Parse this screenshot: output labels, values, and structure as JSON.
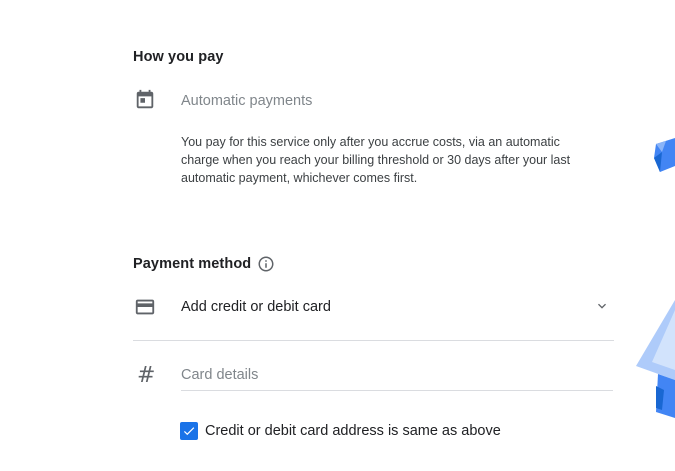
{
  "how_you_pay": {
    "heading": "How you pay",
    "icon": "calendar-icon",
    "type_label": "Automatic payments",
    "description": "You pay for this service only after you accrue costs, via an automatic charge when you reach your billing threshold or 30 days after your last automatic payment, whichever comes first."
  },
  "payment_method": {
    "heading": "Payment method",
    "info_icon": "info-icon",
    "card_select": {
      "icon": "credit-card-icon",
      "label": "Add credit or debit card",
      "dropdown_icon": "chevron-down-icon"
    },
    "card_details": {
      "icon": "hash-icon",
      "glyph": "#",
      "value": "",
      "placeholder": "Card details"
    },
    "same_address": {
      "label": "Credit or debit card address is same as above",
      "checked": true
    }
  },
  "colors": {
    "accent": "#1a73e8",
    "text_primary": "#202124",
    "text_secondary": "#80868b",
    "icon": "#5f6368",
    "divider": "#dadce0"
  }
}
